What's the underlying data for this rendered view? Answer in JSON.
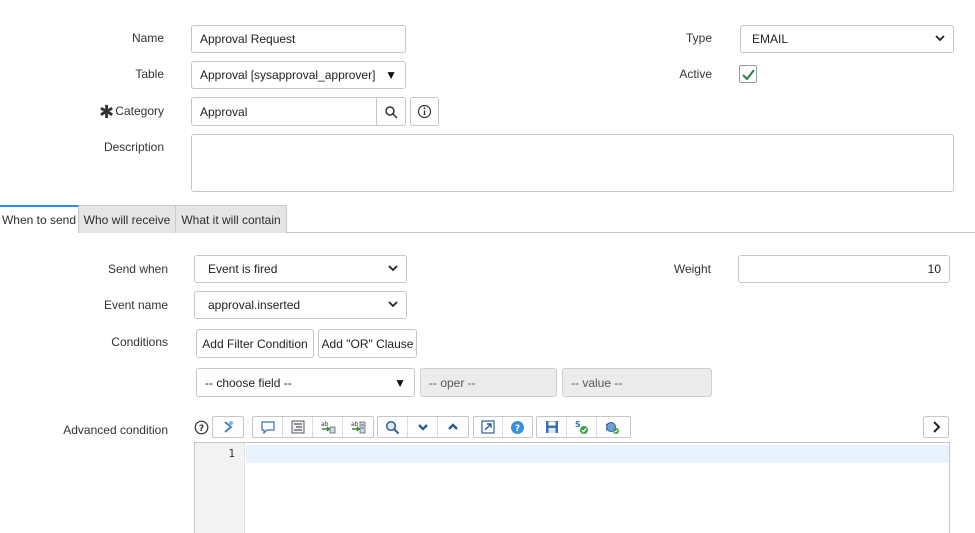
{
  "form": {
    "name_label": "Name",
    "name_value": "Approval Request",
    "table_label": "Table",
    "table_value": "Approval [sysapproval_approver]",
    "category_label": "Category",
    "category_value": "Approval",
    "description_label": "Description",
    "description_value": "",
    "type_label": "Type",
    "type_value": "EMAIL",
    "active_label": "Active",
    "active_checked": true
  },
  "tabs": [
    {
      "label": "When to send",
      "active": true
    },
    {
      "label": "Who will receive",
      "active": false
    },
    {
      "label": "What it will contain",
      "active": false
    }
  ],
  "when": {
    "send_when_label": "Send when",
    "send_when_value": "Event is fired",
    "event_name_label": "Event name",
    "event_name_value": "approval.inserted",
    "weight_label": "Weight",
    "weight_value": "10",
    "conditions_label": "Conditions",
    "add_filter_label": "Add Filter Condition",
    "add_or_label": "Add \"OR\" Clause",
    "choose_field": "-- choose field --",
    "oper": "-- oper --",
    "value": "-- value --",
    "advanced_label": "Advanced condition",
    "line_number": "1"
  },
  "icons": {
    "mandatory": "asterisk-icon",
    "search": "search-icon",
    "info": "info-icon",
    "help": "help-icon",
    "toolbar": [
      "script-include-icon",
      "comment-icon",
      "format-icon",
      "replace-icon",
      "replace-all-icon",
      "search-icon",
      "collapse-icon",
      "expand-icon",
      "fullscreen-icon",
      "help-icon",
      "save-icon",
      "syntax-check-icon",
      "debug-icon"
    ],
    "next": "chevron-right-icon"
  },
  "colors": {
    "accent": "#278efc",
    "check": "#2e7d4a"
  }
}
